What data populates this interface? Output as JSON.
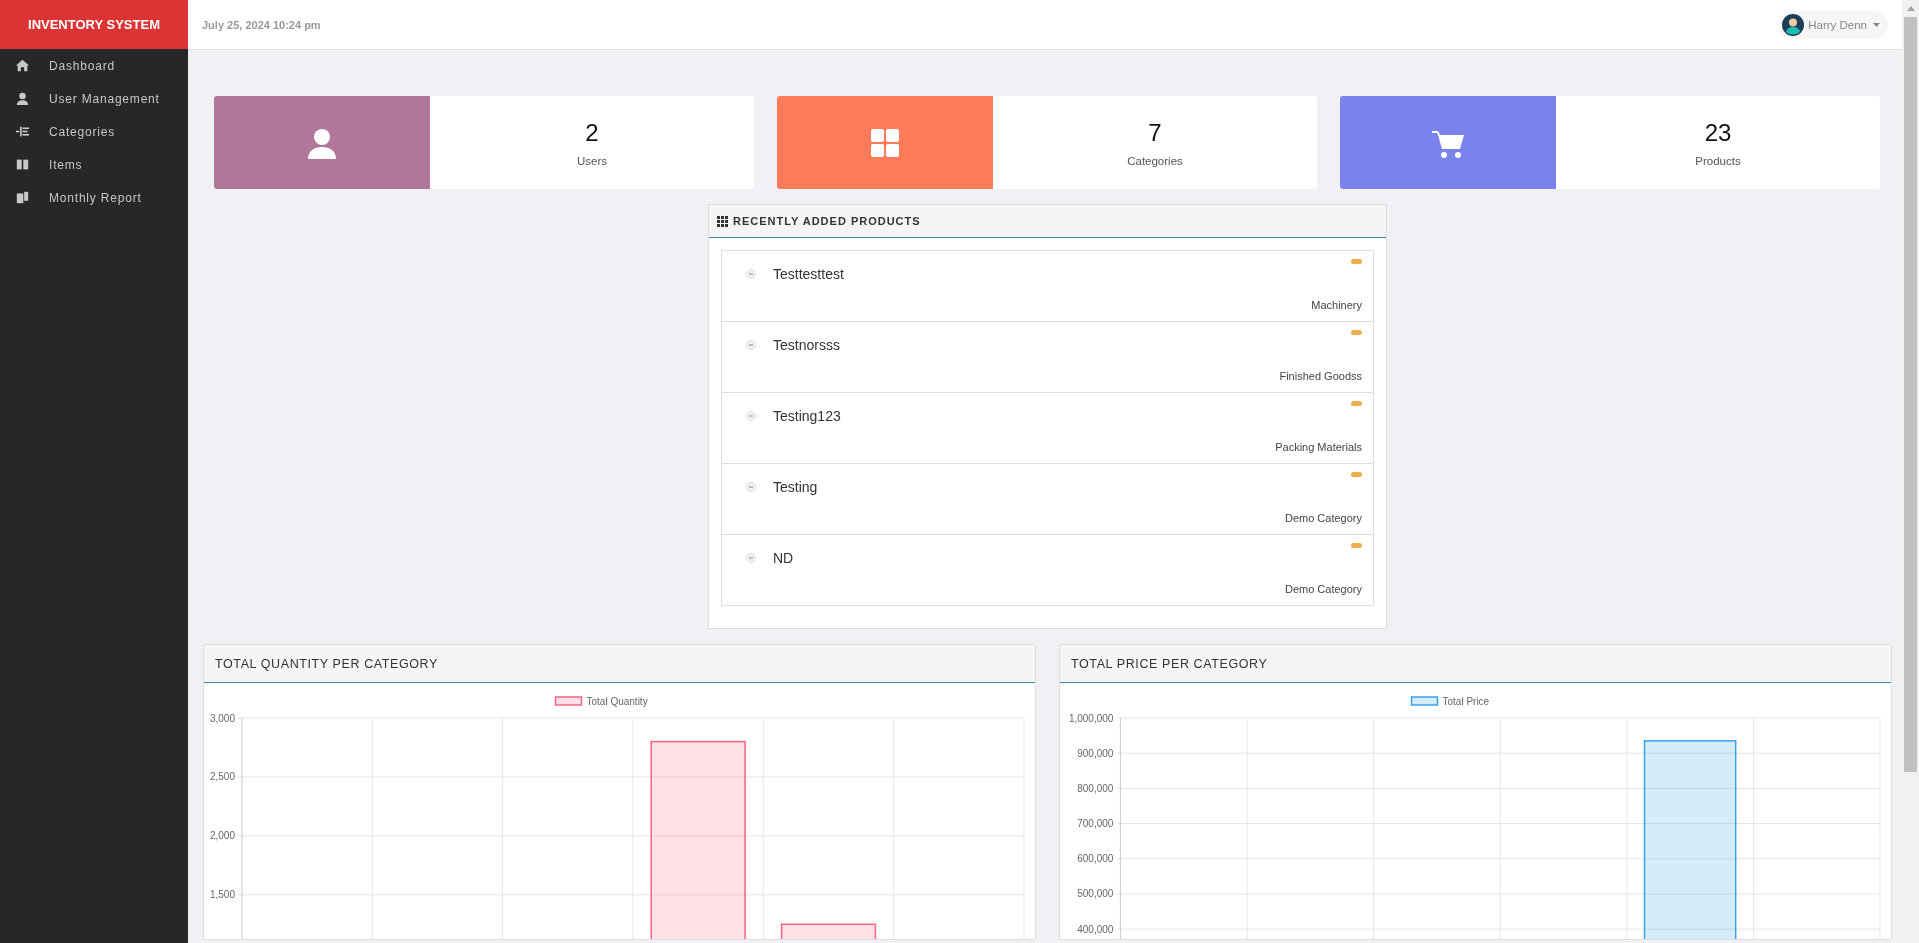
{
  "brand": "INVENTORY SYSTEM",
  "header": {
    "datetime": "July 25, 2024 10:24 pm",
    "user": {
      "name": "Harry Denn"
    }
  },
  "sidebar": {
    "items": [
      {
        "label": "Dashboard",
        "kind": "home"
      },
      {
        "label": "User Management",
        "kind": "user"
      },
      {
        "label": "Categories",
        "kind": "list"
      },
      {
        "label": "Items",
        "kind": "columns"
      },
      {
        "label": "Monthly Report",
        "kind": "files"
      }
    ]
  },
  "stats": [
    {
      "value": "2",
      "label": "Users",
      "kind": "user",
      "color": "#b0779a"
    },
    {
      "value": "7",
      "label": "Categories",
      "kind": "grid",
      "color": "#ff7a59"
    },
    {
      "value": "23",
      "label": "Products",
      "kind": "cart",
      "color": "#7a82ec"
    }
  ],
  "recent_products": {
    "title": "RECENTLY ADDED PRODUCTS",
    "items": [
      {
        "name": "Testtesttest",
        "category": "Machinery"
      },
      {
        "name": "Testnorsss",
        "category": "Finished Goodss"
      },
      {
        "name": "Testing123",
        "category": "Packing Materials"
      },
      {
        "name": "Testing",
        "category": "Demo Category"
      },
      {
        "name": "ND",
        "category": "Demo Category"
      }
    ]
  },
  "charts": [
    {
      "title": "TOTAL QUANTITY PER CATEGORY",
      "chart_data": {
        "type": "bar",
        "grid": true,
        "series": [
          {
            "name": "Total Quantity",
            "color": "#ff6384",
            "values": [
              null,
              null,
              null,
              2800,
              1250,
              null
            ]
          }
        ],
        "ylim": [
          1125,
          3000
        ],
        "yticks": [
          {
            "value": 3000,
            "label": "3,000"
          },
          {
            "value": 2500,
            "label": "2,500"
          },
          {
            "value": 2000,
            "label": "2,000"
          },
          {
            "value": 1500,
            "label": "1,500"
          }
        ]
      }
    },
    {
      "title": "TOTAL PRICE PER CATEGORY",
      "chart_data": {
        "type": "bar",
        "grid": true,
        "series": [
          {
            "name": "Total Price",
            "color": "#36a2eb",
            "values": [
              null,
              null,
              null,
              null,
              935000,
              null
            ]
          }
        ],
        "ylim": [
          372000,
          1000000
        ],
        "yticks": [
          {
            "value": 1000000,
            "label": "1,000,000"
          },
          {
            "value": 900000,
            "label": "900,000"
          },
          {
            "value": 800000,
            "label": "800,000"
          },
          {
            "value": 700000,
            "label": "700,000"
          },
          {
            "value": 600000,
            "label": "600,000"
          },
          {
            "value": 500000,
            "label": "500,000"
          },
          {
            "value": 400000,
            "label": "400,000"
          }
        ]
      }
    }
  ]
}
